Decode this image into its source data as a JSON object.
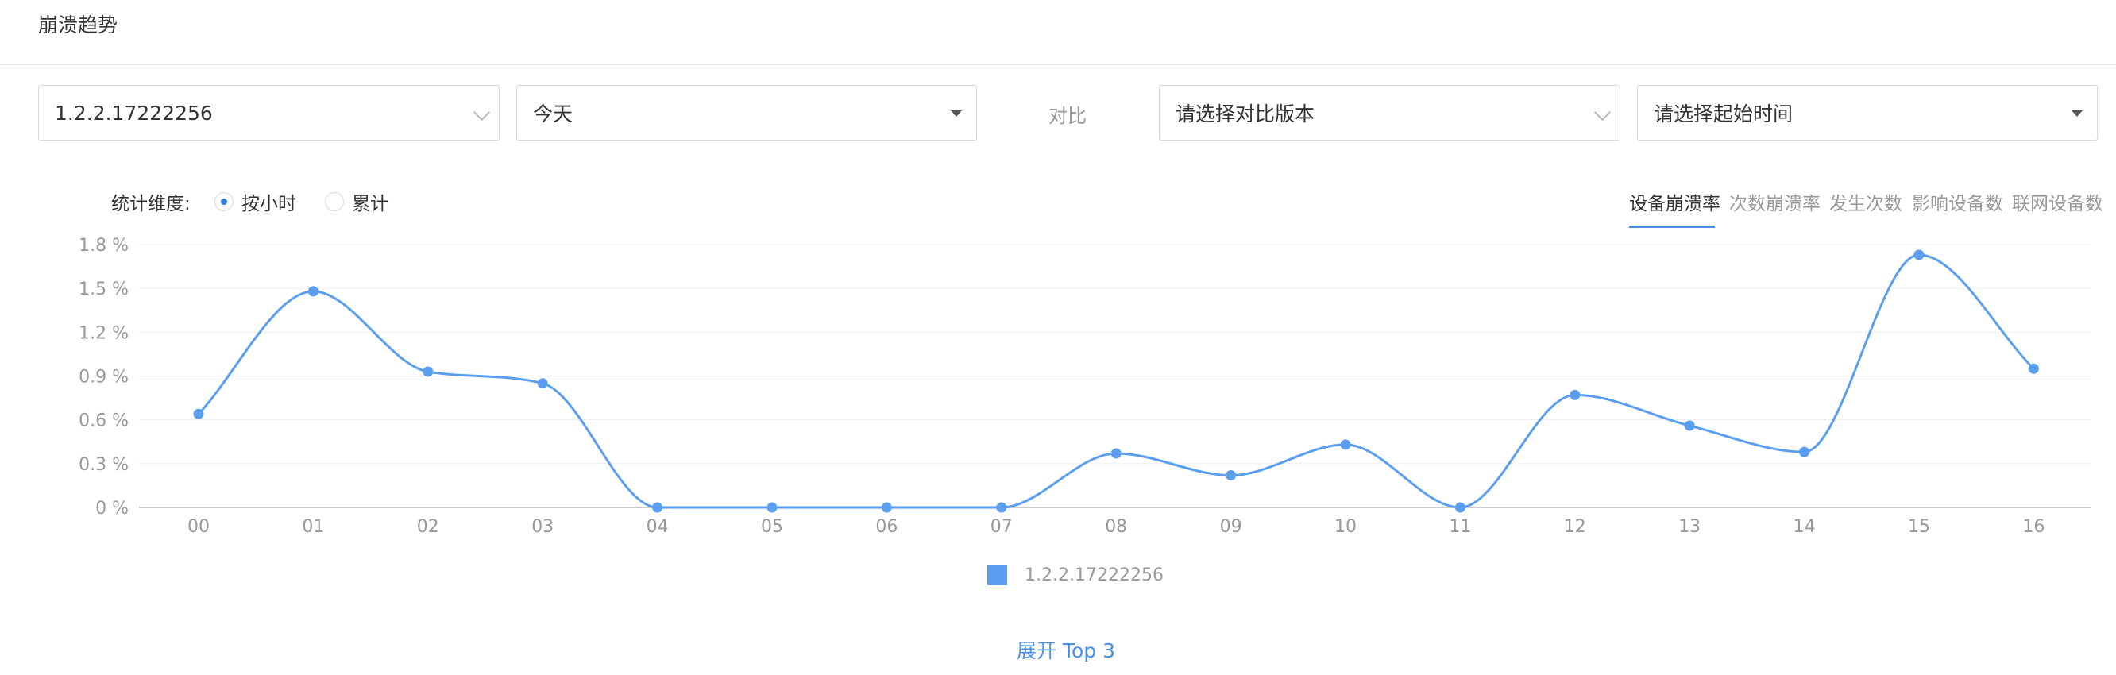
{
  "panel": {
    "title": "崩溃趋势"
  },
  "filters": {
    "version": "1.2.2.17222256",
    "date_range": "今天",
    "compare_label": "对比",
    "compare_version_placeholder": "请选择对比版本",
    "compare_start_placeholder": "请选择起始时间"
  },
  "dimension": {
    "label": "统计维度:",
    "options": [
      "按小时",
      "累计"
    ],
    "selected": "按小时"
  },
  "metric_tabs": [
    "设备崩溃率",
    "次数崩溃率",
    "发生次数",
    "影响设备数",
    "联网设备数"
  ],
  "active_metric": "设备崩溃率",
  "legend": {
    "series_name": "1.2.2.17222256",
    "color": "#5b9ef0"
  },
  "expand_label": "展开 Top 3",
  "chart_data": {
    "type": "line",
    "categories": [
      "00",
      "01",
      "02",
      "03",
      "04",
      "05",
      "06",
      "07",
      "08",
      "09",
      "10",
      "11",
      "12",
      "13",
      "14",
      "15",
      "16"
    ],
    "series": [
      {
        "name": "1.2.2.17222256",
        "values": [
          0.64,
          1.48,
          0.93,
          0.85,
          0,
          0,
          0,
          0,
          0.37,
          0.22,
          0.43,
          0,
          0.77,
          0.56,
          0.38,
          1.73,
          0.95
        ]
      }
    ],
    "y_ticks": [
      "0 %",
      "0.3 %",
      "0.6 %",
      "0.9 %",
      "1.2 %",
      "1.5 %",
      "1.8 %"
    ],
    "ylim": [
      0,
      1.8
    ],
    "grid": true,
    "smooth": true,
    "legend_position": "bottom-center",
    "line_color": "#5b9ef0"
  }
}
